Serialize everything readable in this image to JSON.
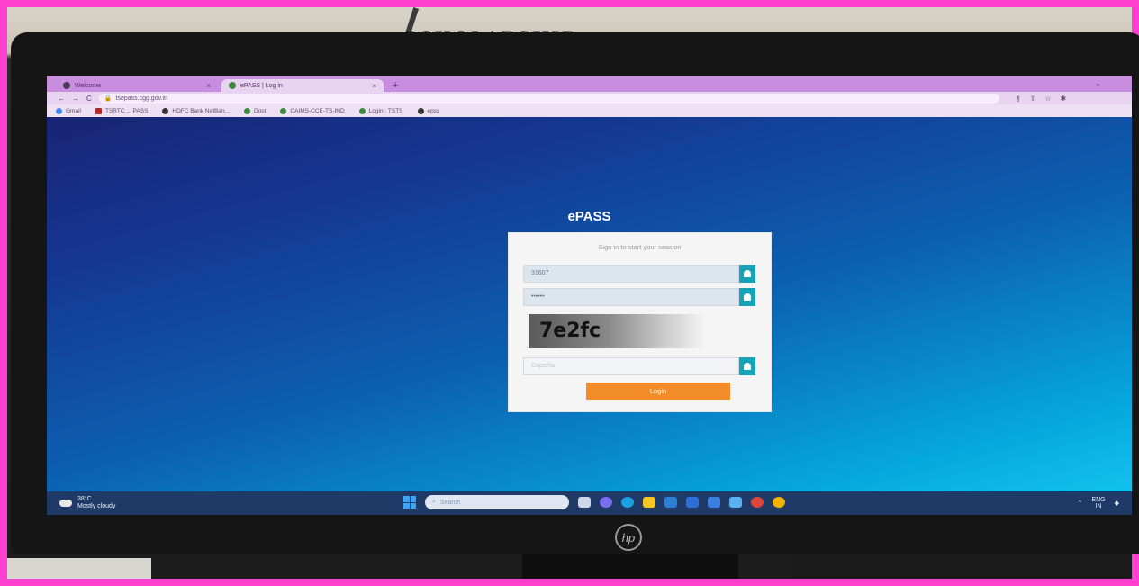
{
  "wall": {
    "text": "SCHOLARSHIP"
  },
  "browser": {
    "tabs": [
      {
        "label": "Welcome",
        "active": false
      },
      {
        "label": "ePASS | Log in",
        "active": true
      }
    ],
    "new_tab_label": "+",
    "address": "tsepass.cgg.gov.in",
    "bookmarks": [
      {
        "label": "Gmail",
        "icon": "google-icon",
        "color": "#4285f4"
      },
      {
        "label": "TSRTC ... PASS",
        "icon": "bus-icon",
        "color": "#b02a2a"
      },
      {
        "label": "HDFC Bank NetBan...",
        "icon": "globe-icon",
        "color": "#333333"
      },
      {
        "label": "Dost",
        "icon": "globe-icon",
        "color": "#3a8a3a"
      },
      {
        "label": "CAIMS-CCE-TS-IND",
        "icon": "globe-icon",
        "color": "#3a8a3a"
      },
      {
        "label": "Login : TSTS",
        "icon": "globe-icon",
        "color": "#3a8a3a"
      },
      {
        "label": "epss",
        "icon": "globe-icon",
        "color": "#333333"
      }
    ]
  },
  "page": {
    "brand": "ePASS",
    "hint": "Sign in to start your session",
    "username_value": "31607",
    "password_value": "••••••",
    "captcha_text": "7e2fc",
    "captcha_placeholder": "Captcha",
    "login_label": "Login",
    "colors": {
      "accent": "#17a2b8",
      "button": "#f28c28"
    }
  },
  "taskbar": {
    "temperature": "38°C",
    "weather": "Mostly cloudy",
    "search_placeholder": "Search",
    "lang_top": "ENG",
    "lang_bottom": "IN"
  },
  "monitor": {
    "brand": "hp"
  }
}
